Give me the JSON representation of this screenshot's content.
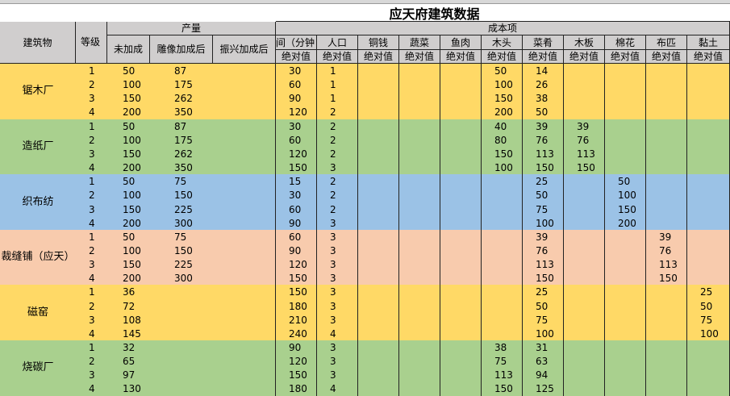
{
  "title": "应天府建筑数据",
  "headers": {
    "building": "建筑物",
    "level": "等级",
    "output_group": "产量",
    "output_cols": [
      "未加成",
      "雕像加成后",
      "振兴加成后"
    ],
    "cost_group": "成本项",
    "cost_cols": [
      "间（分钟",
      "人口",
      "铜钱",
      "蔬菜",
      "鱼肉",
      "木头",
      "菜肴",
      "木板",
      "棉花",
      "布匹",
      "黏土"
    ],
    "abs_label": "绝对值"
  },
  "colors": {
    "header_gray": "#d0cece",
    "yellow": "#ffd966",
    "green": "#a9d08e",
    "blue": "#9bc2e6",
    "peach": "#f8cbad",
    "grid": "#222222"
  },
  "groups": [
    {
      "name": "锯木厂",
      "color": "yellow",
      "rows": [
        {
          "lv": "1",
          "out": [
            "50",
            "87",
            ""
          ],
          "cost": [
            "30",
            "1",
            "",
            "",
            "",
            "50",
            "14",
            "",
            "",
            "",
            ""
          ]
        },
        {
          "lv": "2",
          "out": [
            "100",
            "175",
            ""
          ],
          "cost": [
            "60",
            "1",
            "",
            "",
            "",
            "100",
            "26",
            "",
            "",
            "",
            ""
          ]
        },
        {
          "lv": "3",
          "out": [
            "150",
            "262",
            ""
          ],
          "cost": [
            "90",
            "1",
            "",
            "",
            "",
            "150",
            "38",
            "",
            "",
            "",
            ""
          ]
        },
        {
          "lv": "4",
          "out": [
            "200",
            "350",
            ""
          ],
          "cost": [
            "120",
            "2",
            "",
            "",
            "",
            "200",
            "50",
            "",
            "",
            "",
            ""
          ]
        }
      ]
    },
    {
      "name": "造纸厂",
      "color": "green",
      "rows": [
        {
          "lv": "1",
          "out": [
            "50",
            "87",
            ""
          ],
          "cost": [
            "30",
            "2",
            "",
            "",
            "",
            "40",
            "39",
            "39",
            "",
            "",
            ""
          ]
        },
        {
          "lv": "2",
          "out": [
            "100",
            "175",
            ""
          ],
          "cost": [
            "60",
            "2",
            "",
            "",
            "",
            "80",
            "76",
            "76",
            "",
            "",
            ""
          ]
        },
        {
          "lv": "3",
          "out": [
            "150",
            "262",
            ""
          ],
          "cost": [
            "120",
            "2",
            "",
            "",
            "",
            "150",
            "113",
            "113",
            "",
            "",
            ""
          ]
        },
        {
          "lv": "4",
          "out": [
            "200",
            "350",
            ""
          ],
          "cost": [
            "150",
            "3",
            "",
            "",
            "",
            "100",
            "150",
            "150",
            "",
            "",
            ""
          ]
        }
      ]
    },
    {
      "name": "织布纺",
      "color": "blue",
      "rows": [
        {
          "lv": "1",
          "out": [
            "50",
            "75",
            ""
          ],
          "cost": [
            "15",
            "2",
            "",
            "",
            "",
            "",
            "25",
            "",
            "50",
            "",
            ""
          ]
        },
        {
          "lv": "2",
          "out": [
            "100",
            "150",
            ""
          ],
          "cost": [
            "30",
            "2",
            "",
            "",
            "",
            "",
            "50",
            "",
            "100",
            "",
            ""
          ]
        },
        {
          "lv": "3",
          "out": [
            "150",
            "225",
            ""
          ],
          "cost": [
            "60",
            "2",
            "",
            "",
            "",
            "",
            "75",
            "",
            "150",
            "",
            ""
          ]
        },
        {
          "lv": "4",
          "out": [
            "200",
            "300",
            ""
          ],
          "cost": [
            "90",
            "3",
            "",
            "",
            "",
            "",
            "100",
            "",
            "200",
            "",
            ""
          ]
        }
      ]
    },
    {
      "name": "裁缝铺（应天）",
      "color": "peach",
      "rows": [
        {
          "lv": "1",
          "out": [
            "50",
            "75",
            ""
          ],
          "cost": [
            "60",
            "3",
            "",
            "",
            "",
            "",
            "39",
            "",
            "",
            "39",
            ""
          ]
        },
        {
          "lv": "2",
          "out": [
            "100",
            "150",
            ""
          ],
          "cost": [
            "90",
            "3",
            "",
            "",
            "",
            "",
            "76",
            "",
            "",
            "76",
            ""
          ]
        },
        {
          "lv": "3",
          "out": [
            "150",
            "225",
            ""
          ],
          "cost": [
            "120",
            "3",
            "",
            "",
            "",
            "",
            "113",
            "",
            "",
            "113",
            ""
          ]
        },
        {
          "lv": "4",
          "out": [
            "200",
            "300",
            ""
          ],
          "cost": [
            "150",
            "3",
            "",
            "",
            "",
            "",
            "150",
            "",
            "",
            "150",
            ""
          ]
        }
      ]
    },
    {
      "name": "磁窑",
      "color": "yellow",
      "rows": [
        {
          "lv": "1",
          "out": [
            "36",
            "",
            ""
          ],
          "cost": [
            "150",
            "3",
            "",
            "",
            "",
            "",
            "25",
            "",
            "",
            "",
            "25"
          ]
        },
        {
          "lv": "2",
          "out": [
            "72",
            "",
            ""
          ],
          "cost": [
            "180",
            "3",
            "",
            "",
            "",
            "",
            "50",
            "",
            "",
            "",
            "50"
          ]
        },
        {
          "lv": "3",
          "out": [
            "108",
            "",
            ""
          ],
          "cost": [
            "210",
            "3",
            "",
            "",
            "",
            "",
            "75",
            "",
            "",
            "",
            "75"
          ]
        },
        {
          "lv": "4",
          "out": [
            "145",
            "",
            ""
          ],
          "cost": [
            "240",
            "4",
            "",
            "",
            "",
            "",
            "100",
            "",
            "",
            "",
            "100"
          ]
        }
      ]
    },
    {
      "name": "烧碳厂",
      "color": "green",
      "rows": [
        {
          "lv": "1",
          "out": [
            "32",
            "",
            ""
          ],
          "cost": [
            "90",
            "3",
            "",
            "",
            "",
            "38",
            "31",
            "",
            "",
            "",
            ""
          ]
        },
        {
          "lv": "2",
          "out": [
            "65",
            "",
            ""
          ],
          "cost": [
            "120",
            "3",
            "",
            "",
            "",
            "75",
            "63",
            "",
            "",
            "",
            ""
          ]
        },
        {
          "lv": "3",
          "out": [
            "97",
            "",
            ""
          ],
          "cost": [
            "150",
            "3",
            "",
            "",
            "",
            "113",
            "94",
            "",
            "",
            "",
            ""
          ]
        },
        {
          "lv": "4",
          "out": [
            "130",
            "",
            ""
          ],
          "cost": [
            "180",
            "4",
            "",
            "",
            "",
            "150",
            "125",
            "",
            "",
            "",
            ""
          ]
        }
      ]
    }
  ]
}
